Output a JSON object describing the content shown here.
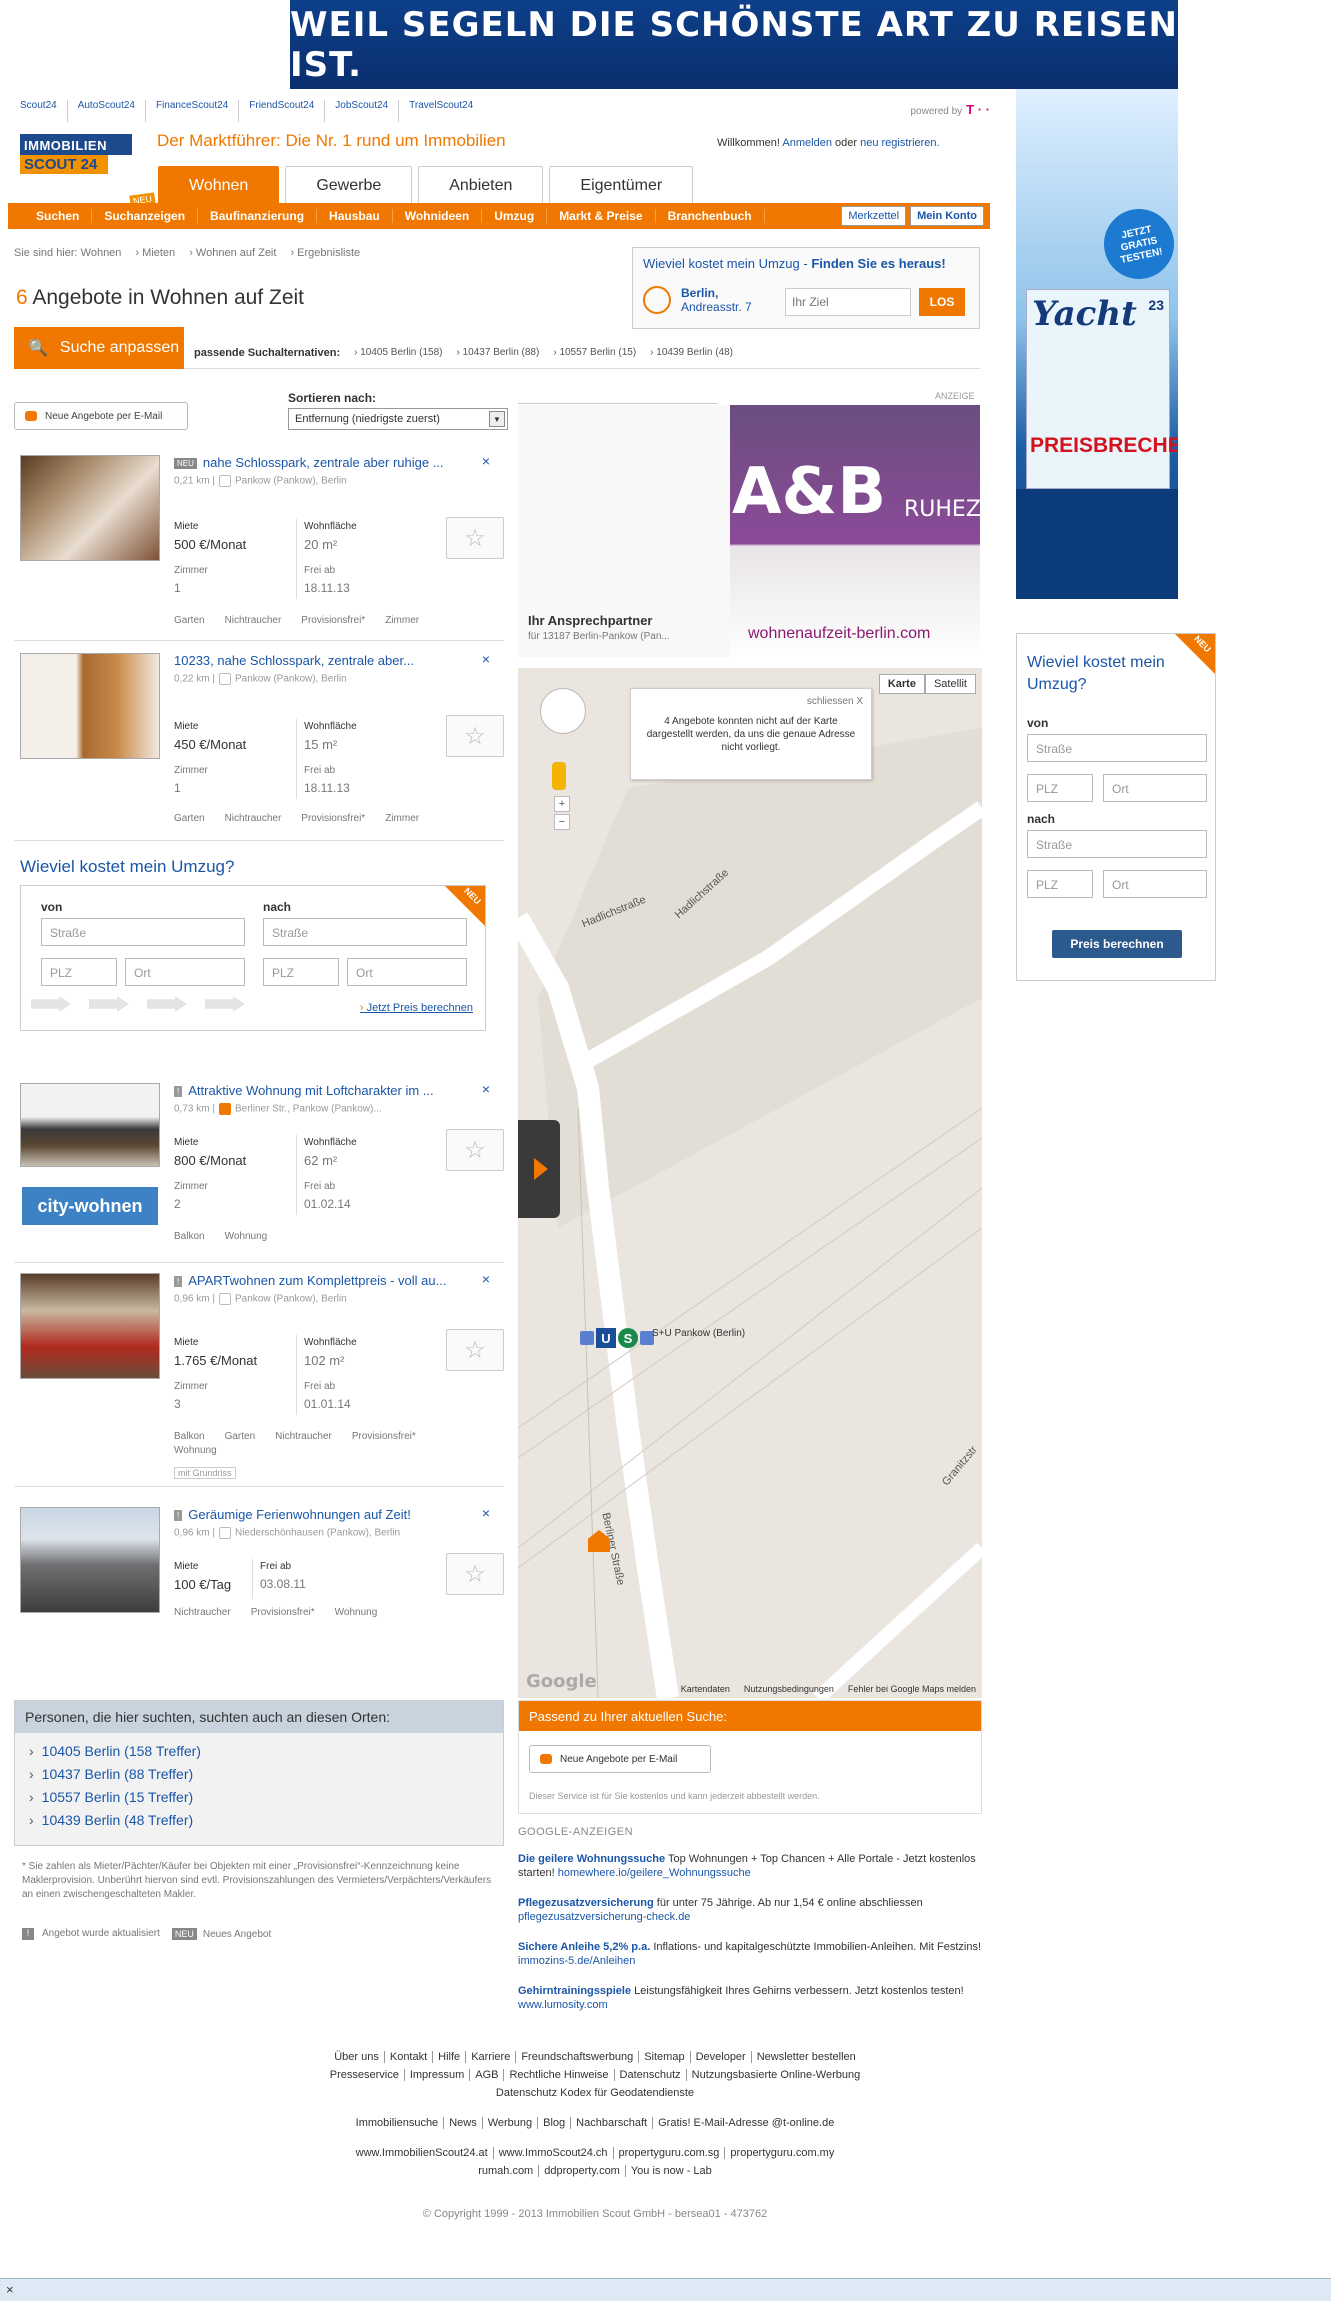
{
  "banner": {
    "text": "WEIL SEGELN DIE SCHÖNSTE ART ZU REISEN IST."
  },
  "sky_ad": {
    "badge": "JETZT GRATIS TESTEN!",
    "magazine": "Yacht",
    "issue": "23",
    "headline": "PREISBRECHER"
  },
  "portals": [
    "Scout24",
    "AutoScout24",
    "FinanceScout24",
    "FriendScout24",
    "JobScout24",
    "TravelScout24"
  ],
  "powered_by": "powered by",
  "logo": {
    "line1": "IMMOBILIEN",
    "line2": "SCOUT 24"
  },
  "claim": "Der Marktführer: Die Nr. 1 rund um Immobilien",
  "welcome": {
    "text": "Willkommen!",
    "login": "Anmelden",
    "or": "oder",
    "register": "neu registrieren."
  },
  "tabs": [
    "Wohnen",
    "Gewerbe",
    "Anbieten",
    "Eigentümer"
  ],
  "neu_tag": "NEU",
  "subnav": [
    "Suchen",
    "Suchanzeigen",
    "Baufinanzierung",
    "Hausbau",
    "Wohnideen",
    "Umzug",
    "Markt & Preise",
    "Branchenbuch"
  ],
  "subnav_buttons": {
    "merkzettel": "Merkzettel",
    "konto": "Mein Konto"
  },
  "breadcrumb": [
    "Sie sind hier: Wohnen",
    "Mieten",
    "Wohnen auf Zeit",
    "Ergebnisliste"
  ],
  "title": {
    "count": "6",
    "text": "Angebote in Wohnen auf Zeit"
  },
  "umzug_top": {
    "question": "Wieviel kostet mein Umzug -",
    "cta": "Finden Sie es heraus!",
    "city": "Berlin,",
    "street": "Andreasstr. 7",
    "placeholder": "Ihr Ziel",
    "go": "LOS"
  },
  "search_adjust": "Suche anpassen",
  "alternatives": {
    "label": "passende Suchalternativen:",
    "items": [
      "10405 Berlin (158)",
      "10437 Berlin (88)",
      "10557 Berlin (15)",
      "10439 Berlin (48)"
    ]
  },
  "newsletter": "Neue Angebote per E-Mail",
  "sort": {
    "label": "Sortieren nach:",
    "value": "Entfernung (niedrigste zuerst)"
  },
  "listings": [
    {
      "tag": "NEU",
      "title": "nahe Schlosspark, zentrale aber ruhige ...",
      "dist": "0,21 km",
      "loc": "Pankow (Pankow), Berlin",
      "k1": "Miete",
      "v1": "500 €/Monat",
      "k2": "Wohnfläche",
      "v2": "20 m²",
      "k3": "Zimmer",
      "v3": "1",
      "k4": "Frei ab",
      "v4": "18.11.13",
      "features": [
        "Garten",
        "Nichtraucher",
        "Provisionsfrei*",
        "Zimmer"
      ]
    },
    {
      "tag": "",
      "title": "10233, nahe Schlosspark, zentrale aber...",
      "dist": "0,22 km",
      "loc": "Pankow (Pankow), Berlin",
      "k1": "Miete",
      "v1": "450 €/Monat",
      "k2": "Wohnfläche",
      "v2": "15 m²",
      "k3": "Zimmer",
      "v3": "1",
      "k4": "Frei ab",
      "v4": "18.11.13",
      "features": [
        "Garten",
        "Nichtraucher",
        "Provisionsfrei*",
        "Zimmer"
      ]
    },
    {
      "tag": "!",
      "title": "Attraktive Wohnung mit Loftcharakter im ...",
      "dist": "0,73 km",
      "loc": "Berliner Str., Pankow (Pankow)...",
      "k1": "Miete",
      "v1": "800 €/Monat",
      "k2": "Wohnfläche",
      "v2": "62 m²",
      "k3": "Zimmer",
      "v3": "2",
      "k4": "Frei ab",
      "v4": "01.02.14",
      "features": [
        "Balkon",
        "Wohnung"
      ],
      "brand": "city-wohnen"
    },
    {
      "tag": "!",
      "title": "APARTwohnen zum Komplettpreis - voll au...",
      "dist": "0,96 km",
      "loc": "Pankow (Pankow), Berlin",
      "k1": "Miete",
      "v1": "1.765 €/Monat",
      "k2": "Wohnfläche",
      "v2": "102 m²",
      "k3": "Zimmer",
      "v3": "3",
      "k4": "Frei ab",
      "v4": "01.01.14",
      "features": [
        "Balkon",
        "Garten",
        "Nichtraucher",
        "Provisionsfrei*"
      ],
      "features2": "Wohnung",
      "floorplan": "mit Grundriss"
    },
    {
      "tag": "!",
      "title": "Geräumige Ferienwohnungen auf Zeit!",
      "dist": "0,96 km",
      "loc": "Niederschönhausen (Pankow), Berlin",
      "k1": "Miete",
      "v1": "100 €/Tag",
      "k4": "Frei ab",
      "v4": "03.08.11",
      "features": [
        "Nichtraucher",
        "Provisionsfrei*",
        "Wohnung"
      ]
    }
  ],
  "umzug_mid": {
    "title": "Wieviel kostet mein Umzug?",
    "von": "von",
    "nach": "nach",
    "strasse": "Straße",
    "plz": "PLZ",
    "ort": "Ort",
    "neu": "NEU",
    "cta": "Jetzt Preis berechnen"
  },
  "ad": {
    "label": "ANZEIGE",
    "brand": "A&B",
    "ruhe": "RUHEZON",
    "contact_h": "Ihr Ansprechpartner",
    "contact_s": "für 13187 Berlin-Pankow (Pan...",
    "url": "wohnenaufzeit-berlin.com"
  },
  "map": {
    "info": "4 Angebote konnten nicht auf der Karte dargestellt werden, da uns die genaue Adresse nicht vorliegt.",
    "close": "schliessen X",
    "type_map": "Karte",
    "type_sat": "Satellit",
    "streets": [
      "Hadlichstraße",
      "Hadlichstraße",
      "Berliner Straße",
      "Granitzstr"
    ],
    "station": "S+U Pankow (Berlin)",
    "footer": [
      "Kartendaten",
      "Nutzungsbedingungen",
      "Fehler bei Google Maps melden"
    ],
    "brand": "Google"
  },
  "passend": {
    "title": "Passend zu Ihrer aktuellen Suche:",
    "button": "Neue Angebote per E-Mail",
    "note": "Dieser Service ist für Sie kostenlos und kann jederzeit abbestellt werden."
  },
  "gads": {
    "title": "GOOGLE-ANZEIGEN",
    "items": [
      {
        "h": "Die geilere Wohnungssuche",
        "t": " Top Wohnungen + Top Chancen + Alle Portale - Jetzt kostenlos starten!",
        "u": "homewhere.io/geilere_Wohnungssuche"
      },
      {
        "h": "Pflegezusatzversicherung",
        "t": " für unter 75 Jährige. Ab nur 1,54 € online abschliessen",
        "u": "pflegezusatzversicherung-check.de"
      },
      {
        "h": "Sichere Anleihe 5,2% p.a.",
        "t": " Inflations- und kapitalgeschützte Immobilien-Anleihen. Mit Festzins!",
        "u": "immozins-5.de/Anleihen"
      },
      {
        "h": "Gehirntrainingsspiele",
        "t": " Leistungsfähigkeit Ihres Gehirns verbessern. Jetzt kostenlos testen!",
        "u": "www.lumosity.com"
      }
    ]
  },
  "personen": {
    "title": "Personen, die hier suchten, suchten auch an diesen Orten:",
    "items": [
      "10405 Berlin (158 Treffer)",
      "10437 Berlin (88 Treffer)",
      "10557 Berlin (15 Treffer)",
      "10439 Berlin (48 Treffer)"
    ]
  },
  "disclaimer": "* Sie zahlen als Mieter/Pächter/Käufer bei Objekten mit einer „Provisionsfrei“-Kennzeichnung keine Maklerprovision. Unberührt hiervon sind evtl. Provisionszahlungen des Vermieters/Verpächters/Verkäufers an einen zwischengeschalteten Makler.",
  "legend": {
    "updated": "Angebot wurde aktualisiert",
    "neu": "NEU",
    "neu_text": "Neues Angebot"
  },
  "footer": {
    "row1": [
      "Über uns",
      "Kontakt",
      "Hilfe",
      "Karriere",
      "Freundschaftswerbung",
      "Sitemap",
      "Developer",
      "Newsletter bestellen"
    ],
    "row2": [
      "Presseservice",
      "Impressum",
      "AGB",
      "Rechtliche Hinweise",
      "Datenschutz",
      "Nutzungsbasierte Online-Werbung"
    ],
    "row3": [
      "Datenschutz Kodex für Geodatendienste"
    ],
    "row4": [
      "Immobiliensuche",
      "News",
      "Werbung",
      "Blog",
      "Nachbarschaft",
      "Gratis! E-Mail-Adresse @t-online.de"
    ],
    "row5": [
      "www.ImmobilienScout24.at",
      "www.ImmoScout24.ch",
      "propertyguru.com.sg",
      "propertyguru.com.my"
    ],
    "row6": [
      "rumah.com",
      "ddproperty.com",
      "You is now - Lab"
    ]
  },
  "copyright": "© Copyright 1999 - 2013 Immobilien Scout GmbH - bersea01 - 473762",
  "umzug_side": {
    "title": "Wieviel kostet mein Umzug?",
    "neu": "NEU",
    "von": "von",
    "nach": "nach",
    "strasse": "Straße",
    "plz": "PLZ",
    "ort": "Ort",
    "button": "Preis berechnen"
  },
  "statusbar": "×"
}
